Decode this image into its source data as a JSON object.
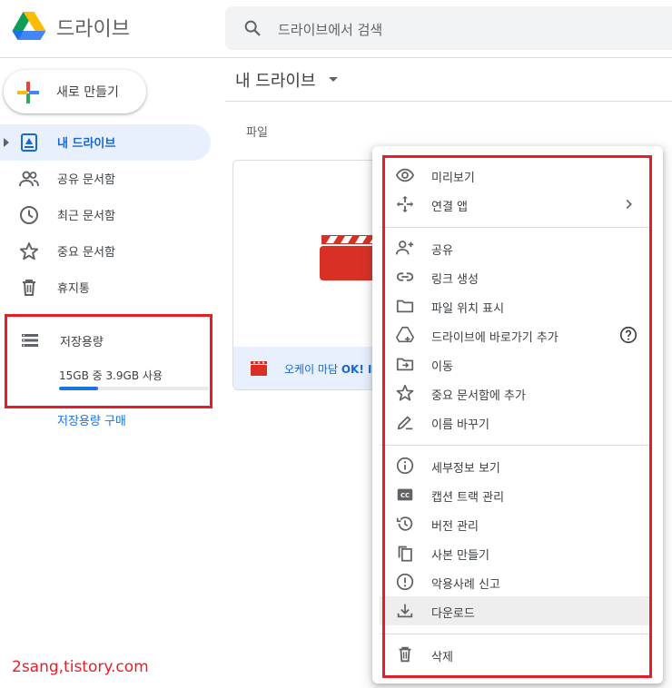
{
  "header": {
    "app_title": "드라이브",
    "search_placeholder": "드라이브에서 검색"
  },
  "sidebar": {
    "new_button_label": "새로 만들기",
    "items": [
      {
        "label": "내 드라이브",
        "icon": "my-drive-icon",
        "active": true
      },
      {
        "label": "공유 문서함",
        "icon": "shared-people-icon",
        "active": false
      },
      {
        "label": "최근 문서함",
        "icon": "clock-icon",
        "active": false
      },
      {
        "label": "중요 문서함",
        "icon": "star-icon",
        "active": false
      },
      {
        "label": "휴지통",
        "icon": "trash-icon",
        "active": false
      }
    ],
    "storage": {
      "label": "저장용량",
      "usage_text": "15GB 중 3.9GB 사용",
      "used_fraction": 0.26,
      "buy_link": "저장용량 구매"
    }
  },
  "main": {
    "title": "내 드라이브",
    "section_label": "파일",
    "file": {
      "name_prefix": "오케이 마담 ",
      "name_bold": "OK! I"
    }
  },
  "context_menu": {
    "items": [
      {
        "label": "미리보기",
        "icon": "eye-icon"
      },
      {
        "label": "연결 앱",
        "icon": "move-arrows-icon",
        "submenu": true
      },
      {
        "label": "공유",
        "icon": "person-add-icon"
      },
      {
        "label": "링크 생성",
        "icon": "link-icon"
      },
      {
        "label": "파일 위치 표시",
        "icon": "folder-icon"
      },
      {
        "label": "드라이브에 바로가기 추가",
        "icon": "drive-shortcut-icon",
        "help": true
      },
      {
        "label": "이동",
        "icon": "move-to-folder-icon"
      },
      {
        "label": "중요 문서함에 추가",
        "icon": "star-icon"
      },
      {
        "label": "이름 바꾸기",
        "icon": "pencil-icon"
      },
      {
        "label": "세부정보 보기",
        "icon": "info-icon"
      },
      {
        "label": "캡션 트랙 관리",
        "icon": "cc-icon"
      },
      {
        "label": "버전 관리",
        "icon": "history-icon"
      },
      {
        "label": "사본 만들기",
        "icon": "copy-icon"
      },
      {
        "label": "악용사례 신고",
        "icon": "report-icon"
      },
      {
        "label": "다운로드",
        "icon": "download-icon",
        "hovered": true
      },
      {
        "label": "삭제",
        "icon": "trash-icon"
      }
    ]
  },
  "watermark": "2sang,tistory.com",
  "colors": {
    "accent": "#1a73e8",
    "highlight_box": "#e3202a",
    "active_nav_bg": "#e8f0fe"
  }
}
